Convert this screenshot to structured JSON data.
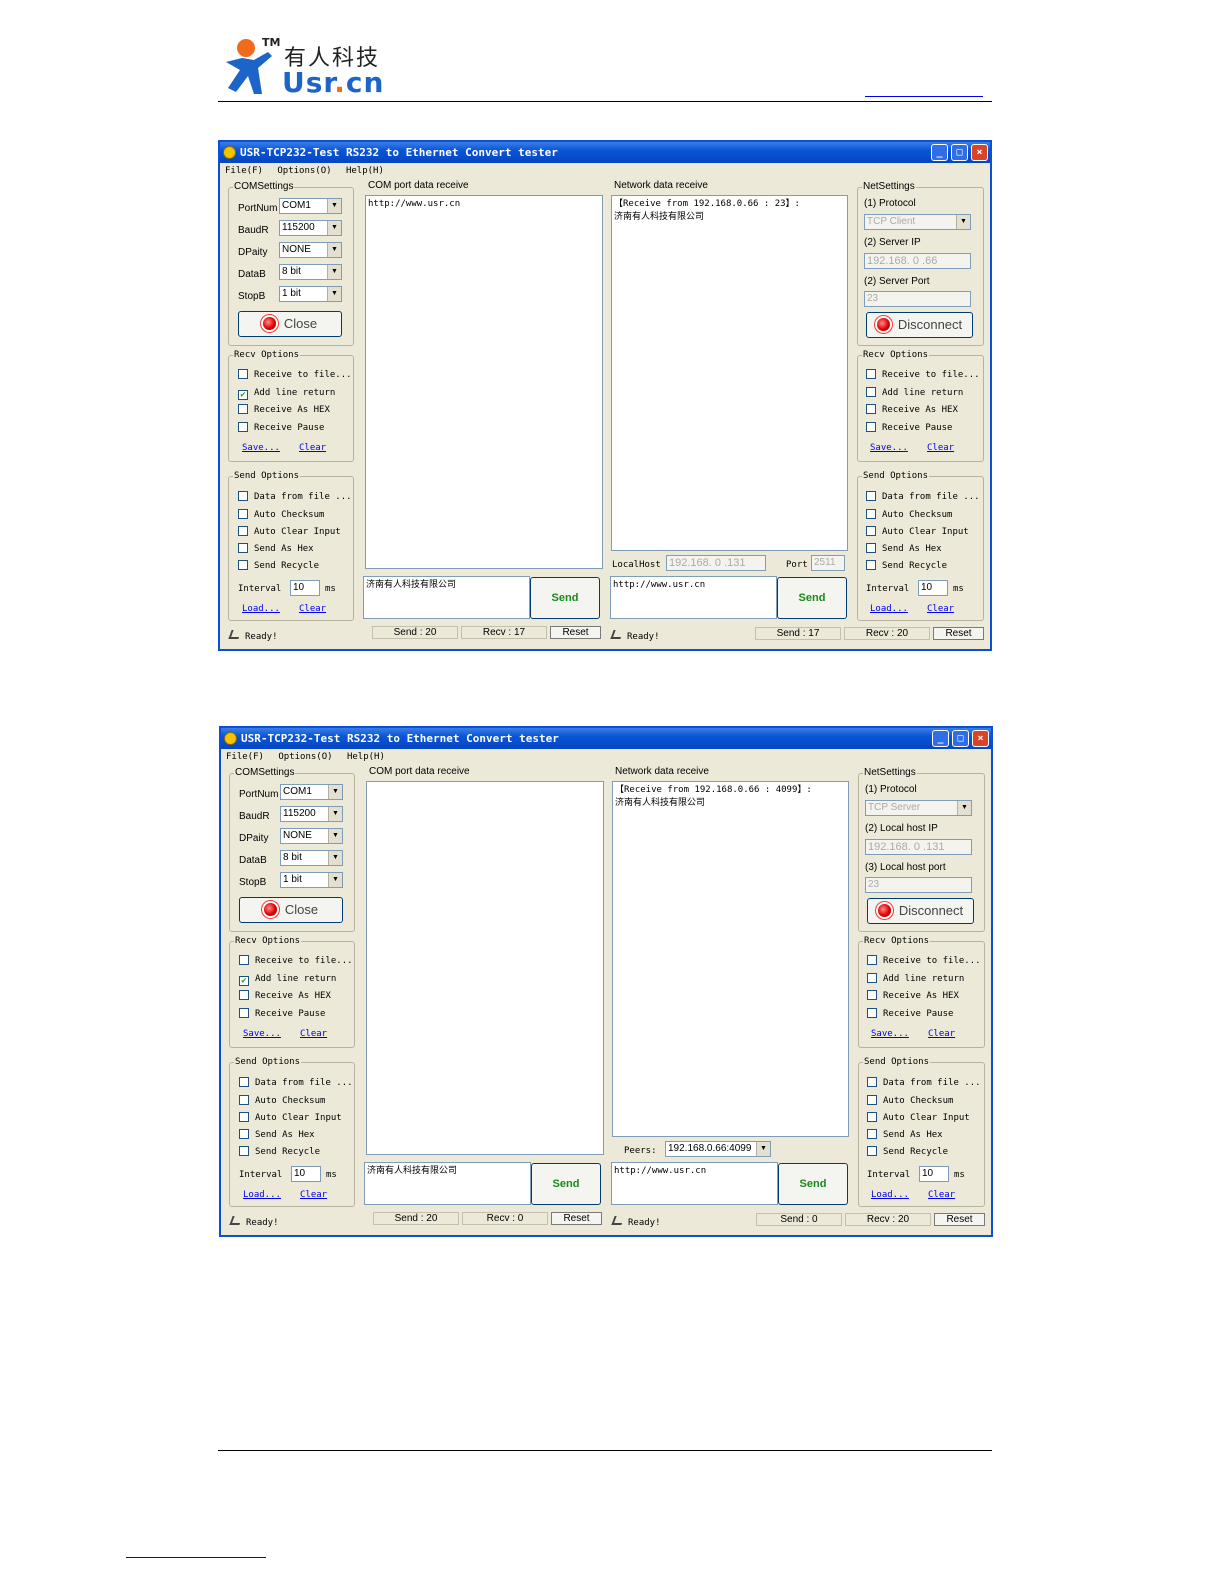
{
  "logo": {
    "cn": "有人科技",
    "tm": "TM",
    "usr": "Usr",
    "dot": ".",
    "cn_domain": "cn"
  },
  "windows": [
    {
      "title": "USR-TCP232-Test  RS232 to Ethernet Convert tester",
      "menu": [
        "File(F)",
        "Options(O)",
        "Help(H)"
      ],
      "com": {
        "group_title": "COMSettings",
        "port_label": "PortNum",
        "port_value": "COM1",
        "baud_label": "BaudR",
        "baud_value": "115200",
        "parity_label": "DPaity",
        "parity_value": "NONE",
        "databits_label": "DataB",
        "databits_value": "8 bit",
        "stopbits_label": "StopB",
        "stopbits_value": "1 bit",
        "close_label": "Close"
      },
      "recv_left": {
        "title": "Recv Options",
        "options": [
          {
            "label": "Receive to file...",
            "checked": false
          },
          {
            "label": "Add line return",
            "checked": true
          },
          {
            "label": "Receive As HEX",
            "checked": false
          },
          {
            "label": "Receive Pause",
            "checked": false
          }
        ],
        "save": "Save...",
        "clear": "Clear"
      },
      "send_left": {
        "title": "Send Options",
        "options": [
          {
            "label": "Data from file ...",
            "checked": false
          },
          {
            "label": "Auto Checksum",
            "checked": false
          },
          {
            "label": "Auto Clear Input",
            "checked": false
          },
          {
            "label": "Send As Hex",
            "checked": false
          },
          {
            "label": "Send Recycle",
            "checked": false
          }
        ],
        "interval_label": "Interval",
        "interval_value": "10",
        "interval_unit": "ms",
        "load": "Load...",
        "clear": "Clear"
      },
      "com_recv": {
        "title": "COM port data receive",
        "content": "http://www.usr.cn"
      },
      "com_send": {
        "content": "济南有人科技有限公司",
        "send": "Send"
      },
      "com_status": {
        "ready": "Ready!",
        "send": "Send : 20",
        "recv": "Recv : 17",
        "reset": "Reset"
      },
      "net_recv": {
        "title": "Network data receive",
        "line1": "【Receive from 192.168.0.66 : 23】:",
        "line2": "济南有人科技有限公司"
      },
      "net_local": {
        "label1": "LocalHost",
        "value1": "192.168. 0 .131",
        "label2": "Port",
        "value2": "2511"
      },
      "net_send": {
        "content": "http://www.usr.cn",
        "send": "Send"
      },
      "net_status": {
        "ready": "Ready!",
        "send": "Send : 17",
        "recv": "Recv : 20",
        "reset": "Reset"
      },
      "netsettings": {
        "group_title": "NetSettings",
        "l1": "(1) Protocol",
        "v1": "TCP Client",
        "l2": "(2) Server IP",
        "v2": "192.168. 0 .66",
        "l3": "(2) Server Port",
        "v3": "23",
        "btn": "Disconnect"
      },
      "recv_right": {
        "title": "Recv Options",
        "options": [
          {
            "label": "Receive to file...",
            "checked": false
          },
          {
            "label": "Add line return",
            "checked": false
          },
          {
            "label": "Receive As HEX",
            "checked": false
          },
          {
            "label": "Receive Pause",
            "checked": false
          }
        ],
        "save": "Save...",
        "clear": "Clear"
      },
      "send_right": {
        "title": "Send Options",
        "options": [
          {
            "label": "Data from file ...",
            "checked": false
          },
          {
            "label": "Auto Checksum",
            "checked": false
          },
          {
            "label": "Auto Clear Input",
            "checked": false
          },
          {
            "label": "Send As Hex",
            "checked": false
          },
          {
            "label": "Send Recycle",
            "checked": false
          }
        ],
        "interval_label": "Interval",
        "interval_value": "10",
        "interval_unit": "ms",
        "load": "Load...",
        "clear": "Clear"
      }
    },
    {
      "title": "USR-TCP232-Test  RS232 to Ethernet Convert tester",
      "menu": [
        "File(F)",
        "Options(O)",
        "Help(H)"
      ],
      "com": {
        "group_title": "COMSettings",
        "port_label": "PortNum",
        "port_value": "COM1",
        "baud_label": "BaudR",
        "baud_value": "115200",
        "parity_label": "DPaity",
        "parity_value": "NONE",
        "databits_label": "DataB",
        "databits_value": "8 bit",
        "stopbits_label": "StopB",
        "stopbits_value": "1 bit",
        "close_label": "Close"
      },
      "recv_left": {
        "title": "Recv Options",
        "options": [
          {
            "label": "Receive to file...",
            "checked": false
          },
          {
            "label": "Add line return",
            "checked": true
          },
          {
            "label": "Receive As HEX",
            "checked": false
          },
          {
            "label": "Receive Pause",
            "checked": false
          }
        ],
        "save": "Save...",
        "clear": "Clear"
      },
      "send_left": {
        "title": "Send Options",
        "options": [
          {
            "label": "Data from file ...",
            "checked": false
          },
          {
            "label": "Auto Checksum",
            "checked": false
          },
          {
            "label": "Auto Clear Input",
            "checked": false
          },
          {
            "label": "Send As Hex",
            "checked": false
          },
          {
            "label": "Send Recycle",
            "checked": false
          }
        ],
        "interval_label": "Interval",
        "interval_value": "10",
        "interval_unit": "ms",
        "load": "Load...",
        "clear": "Clear"
      },
      "com_recv": {
        "title": "COM port data receive",
        "content": ""
      },
      "com_send": {
        "content": "济南有人科技有限公司",
        "send": "Send"
      },
      "com_status": {
        "ready": "Ready!",
        "send": "Send : 20",
        "recv": "Recv : 0",
        "reset": "Reset"
      },
      "net_recv": {
        "title": "Network data receive",
        "line1": "【Receive from 192.168.0.66 : 4099】:",
        "line2": "济南有人科技有限公司"
      },
      "net_local": {
        "label1": "Peers:",
        "value1": "192.168.0.66:4099"
      },
      "net_send": {
        "content": "http://www.usr.cn",
        "send": "Send"
      },
      "net_status": {
        "ready": "Ready!",
        "send": "Send : 0",
        "recv": "Recv : 20",
        "reset": "Reset"
      },
      "netsettings": {
        "group_title": "NetSettings",
        "l1": "(1) Protocol",
        "v1": "TCP Server",
        "l2": "(2) Local host IP",
        "v2": "192.168. 0 .131",
        "l3": "(3) Local host port",
        "v3": "23",
        "btn": "Disconnect"
      },
      "recv_right": {
        "title": "Recv Options",
        "options": [
          {
            "label": "Receive to file...",
            "checked": false
          },
          {
            "label": "Add line return",
            "checked": false
          },
          {
            "label": "Receive As HEX",
            "checked": false
          },
          {
            "label": "Receive Pause",
            "checked": false
          }
        ],
        "save": "Save...",
        "clear": "Clear"
      },
      "send_right": {
        "title": "Send Options",
        "options": [
          {
            "label": "Data from file ...",
            "checked": false
          },
          {
            "label": "Auto Checksum",
            "checked": false
          },
          {
            "label": "Auto Clear Input",
            "checked": false
          },
          {
            "label": "Send As Hex",
            "checked": false
          },
          {
            "label": "Send Recycle",
            "checked": false
          }
        ],
        "interval_label": "Interval",
        "interval_value": "10",
        "interval_unit": "ms",
        "load": "Load...",
        "clear": "Clear"
      }
    }
  ]
}
